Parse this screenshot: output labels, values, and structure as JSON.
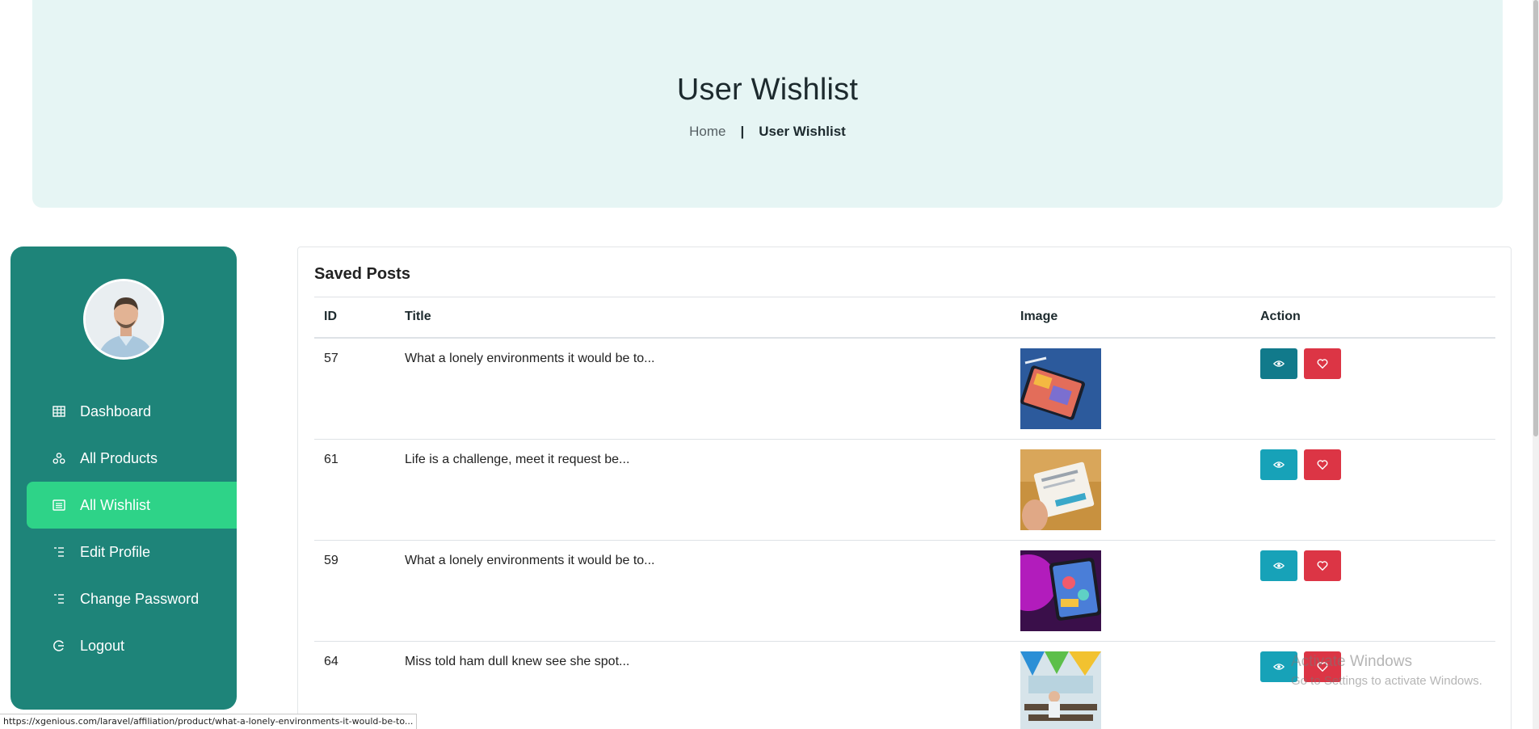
{
  "hero": {
    "title": "User Wishlist",
    "breadcrumb": {
      "home": "Home",
      "separator": "|",
      "current": "User Wishlist"
    }
  },
  "sidebar": {
    "items": [
      {
        "label": "Dashboard",
        "icon": "grid-icon",
        "active": false
      },
      {
        "label": "All Products",
        "icon": "products-icon",
        "active": false
      },
      {
        "label": "All Wishlist",
        "icon": "list-icon",
        "active": true
      },
      {
        "label": "Edit Profile",
        "icon": "list-lines-icon",
        "active": false
      },
      {
        "label": "Change Password",
        "icon": "list-lines-icon",
        "active": false
      },
      {
        "label": "Logout",
        "icon": "logout-icon",
        "active": false
      }
    ]
  },
  "card": {
    "title": "Saved Posts",
    "columns": [
      "ID",
      "Title",
      "Image",
      "Action"
    ],
    "rows": [
      {
        "id": "57",
        "title": "What a lonely environments it would be to..."
      },
      {
        "id": "61",
        "title": "Life is a challenge, meet it request be..."
      },
      {
        "id": "59",
        "title": "What a lonely environments it would be to..."
      },
      {
        "id": "64",
        "title": "Miss told ham dull knew see she spot..."
      }
    ]
  },
  "statusbar": {
    "url": "https://xgenious.com/laravel/affiliation/product/what-a-lonely-environments-it-would-be-to..."
  },
  "watermark": {
    "line1": "Activate Windows",
    "line2": "Go to Settings to activate Windows."
  },
  "colors": {
    "sidebar": "#1e8479",
    "active": "#2ed388",
    "view": "#17a2b8",
    "favorite": "#dc3545",
    "hero": "#e6f5f4"
  }
}
